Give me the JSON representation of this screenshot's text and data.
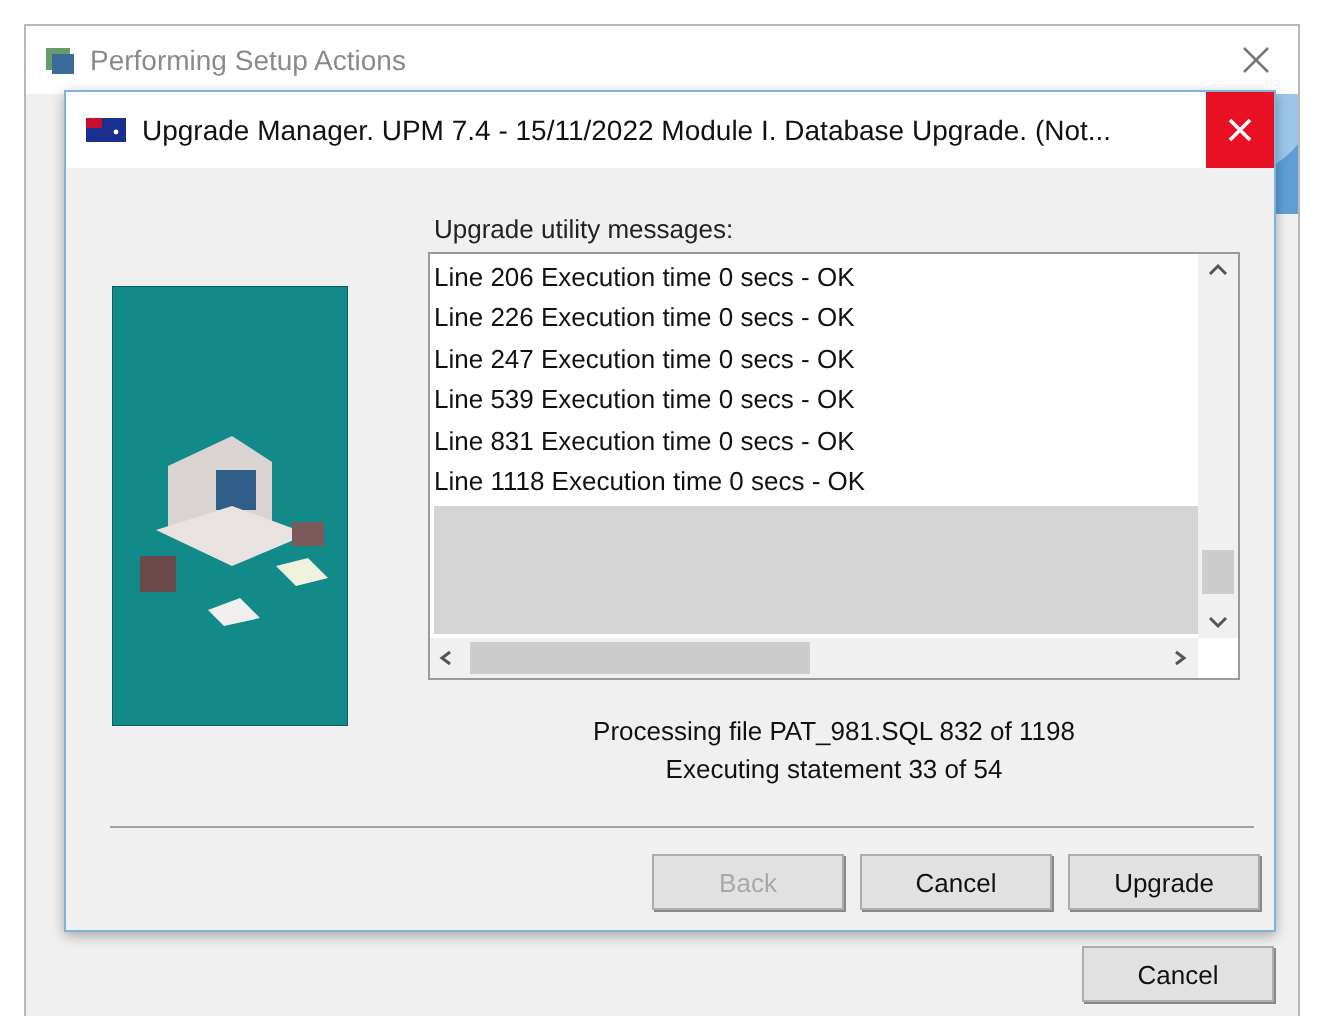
{
  "background_window": {
    "title": "Performing Setup Actions",
    "buttons": [
      {
        "label": "Cancel",
        "disabled": false
      }
    ]
  },
  "dialog": {
    "title": "Upgrade Manager. UPM  7.4 - 15/11/2022  Module I. Database Upgrade. (Not...",
    "messages_label": "Upgrade utility messages:",
    "messages": [
      "Line 206 Execution time 0 secs - OK",
      "Line 226 Execution time 0 secs - OK",
      "Line 247 Execution time 0 secs - OK",
      "Line 539 Execution time 0 secs - OK",
      "Line 831 Execution time 0 secs - OK",
      "Line 1118 Execution time 0 secs - OK"
    ],
    "status_lines": [
      "Processing file PAT_981.SQL 832 of 1198",
      "Executing statement 33 of 54"
    ],
    "buttons": [
      {
        "label": "Back",
        "disabled": true
      },
      {
        "label": "Cancel",
        "disabled": false
      },
      {
        "label": "Upgrade",
        "disabled": false
      }
    ]
  }
}
